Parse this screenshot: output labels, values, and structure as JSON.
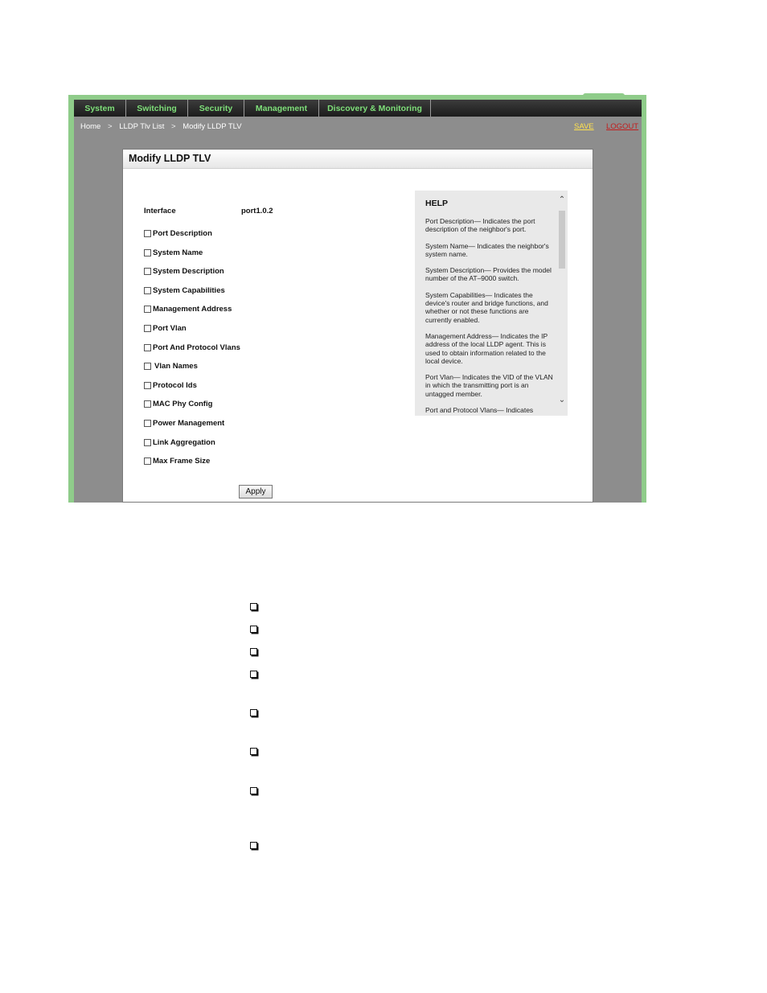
{
  "nav": {
    "items": [
      "System",
      "Switching",
      "Security",
      "Management",
      "Discovery & Monitoring"
    ]
  },
  "breadcrumb": {
    "home": "Home",
    "separator": ">",
    "list": "LLDP Tlv List",
    "current": "Modify LLDP TLV"
  },
  "header_links": {
    "save": "SAVE",
    "logout": "LOGOUT"
  },
  "panel": {
    "title": "Modify LLDP TLV",
    "interface_label": "Interface",
    "interface_value": "port1.0.2",
    "tlvs": [
      {
        "label": "Port Description",
        "checked": false
      },
      {
        "label": "System Name",
        "checked": false
      },
      {
        "label": "System Description",
        "checked": false
      },
      {
        "label": "System Capabilities",
        "checked": false
      },
      {
        "label": "Management Address",
        "checked": false
      },
      {
        "label": "Port Vlan",
        "checked": false
      },
      {
        "label": "Port And Protocol Vlans",
        "checked": false
      },
      {
        "label": "Vlan Names",
        "checked": false
      },
      {
        "label": "Protocol Ids",
        "checked": false
      },
      {
        "label": "MAC Phy Config",
        "checked": false
      },
      {
        "label": "Power Management",
        "checked": false
      },
      {
        "label": "Link Aggregation",
        "checked": false
      },
      {
        "label": "Max Frame Size",
        "checked": false
      }
    ],
    "apply_label": "Apply"
  },
  "help": {
    "title": "HELP",
    "paragraphs": [
      "Port Description— Indicates the port description of the neighbor's port.",
      "System Name— Indicates the neighbor's system name.",
      "System Description— Provides the model number of the AT–9000 switch.",
      "System Capabilities— Indicates the device's router and bridge functions, and whether or not these functions are currently enabled.",
      "Management Address— Indicates the IP address of the local LLDP agent. This is used to obtain information related to the local device.",
      "Port Vlan— Indicates the VID of the VLAN in which the transmitting port is an untagged member.",
      "Port and Protocol Vlans— Indicates whether the device supports port and"
    ]
  },
  "colors": {
    "frame_green": "#8fcc8a",
    "nav_text": "#7fe07a",
    "save_link": "#ffe14d",
    "logout_link": "#c21d1d",
    "app_background": "#8d8d8d"
  }
}
